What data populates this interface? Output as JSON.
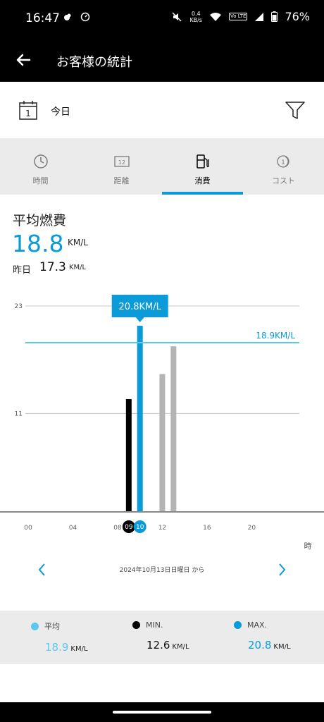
{
  "status_bar": {
    "time": "16:47",
    "speed_value": "0.4",
    "speed_unit": "KB/s",
    "volte": "Vo LTE",
    "battery": "76%"
  },
  "app_bar": {
    "title": "お客様の統計"
  },
  "date_bar": {
    "label": "今日",
    "calendar_day": "1"
  },
  "tabs": [
    {
      "label": "時間",
      "icon": "clock-icon",
      "active": false
    },
    {
      "label": "距離",
      "icon": "odometer-icon",
      "active": false
    },
    {
      "label": "消費",
      "icon": "fuel-pump-icon",
      "active": true
    },
    {
      "label": "コスト",
      "icon": "coin-icon",
      "active": false
    }
  ],
  "stats": {
    "title": "平均燃費",
    "value": "18.8",
    "unit": "KM/L",
    "yesterday_label": "昨日",
    "yesterday_value": "17.3",
    "yesterday_unit": "KM/L"
  },
  "chart_data": {
    "type": "bar",
    "x": [
      "09",
      "10",
      "12",
      "13"
    ],
    "values": [
      12.6,
      20.8,
      15.4,
      18.5
    ],
    "x_ticks": [
      "00",
      "04",
      "08",
      "09",
      "10",
      "12",
      "16",
      "20"
    ],
    "x_domain": [
      0,
      23
    ],
    "xlabel": "時",
    "y_ticks": [
      11,
      23
    ],
    "ylim": [
      0,
      23
    ],
    "average_line": {
      "value": 18.9,
      "label": "18.9KM/L"
    },
    "tooltip": {
      "x": "10",
      "label": "20.8KM/L"
    },
    "colors": {
      "selected_min": "#000000",
      "selected_max": "#0a9bd8",
      "other": "#b4b4b4",
      "average": "#5cc7ef"
    }
  },
  "navigation": {
    "range_text": "2024年10月13日日曜日 から"
  },
  "summary": [
    {
      "label": "平均",
      "value": "18.9",
      "unit": "KM/L",
      "color": "#5cc7ef",
      "value_color": "#5cc7ef"
    },
    {
      "label": "MIN.",
      "value": "12.6",
      "unit": "KM/L",
      "color": "#000000",
      "value_color": "#111111"
    },
    {
      "label": "MAX.",
      "value": "20.8",
      "unit": "KM/L",
      "color": "#0a9bd8",
      "value_color": "#0a9bd8"
    }
  ],
  "colors": {
    "accent": "#0a9bd8",
    "tab_bg": "#ebebeb",
    "header_bg": "#000000"
  }
}
